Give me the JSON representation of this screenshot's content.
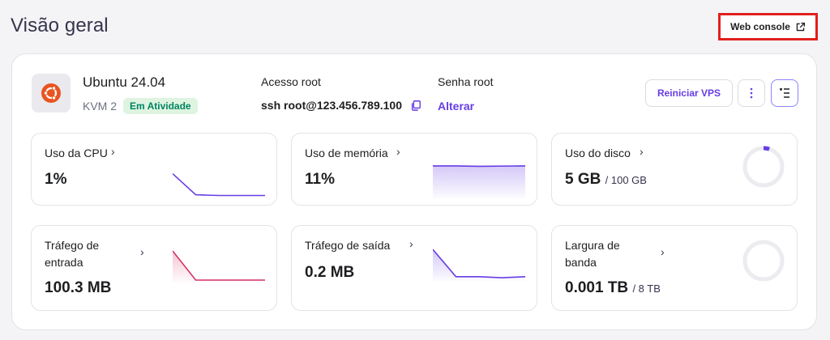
{
  "header": {
    "title": "Visão geral",
    "web_console_label": "Web console"
  },
  "server": {
    "os_name": "Ubuntu 24.04",
    "plan": "KVM 2",
    "status": "Em Atividade",
    "root_access_label": "Acesso root",
    "root_access_value": "ssh root@123.456.789.100",
    "password_label": "Senha root",
    "password_action": "Alterar",
    "restart_label": "Reiniciar VPS"
  },
  "metrics": {
    "cpu": {
      "label": "Uso da CPU",
      "value": "1%",
      "trend": [
        0.7,
        0.08,
        0.06,
        0.06
      ]
    },
    "memory": {
      "label": "Uso de memória",
      "value": "11%",
      "trend": [
        0.93,
        0.93,
        0.92,
        0.93
      ]
    },
    "disk": {
      "label": "Uso do disco",
      "value": "5 GB",
      "total": "/ 100 GB",
      "fraction": 0.05
    },
    "traffic_in": {
      "label_line1": "Tráfego de",
      "label_line2": "entrada",
      "value": "100.3 MB",
      "trend": [
        0.95,
        0.05,
        0.05,
        0.05
      ]
    },
    "traffic_out": {
      "label": "Tráfego de saída",
      "value": "0.2 MB",
      "trend": [
        0.9,
        0.1,
        0.1,
        0.07,
        0.1
      ]
    },
    "bandwidth": {
      "label_line1": "Largura de",
      "label_line2": "banda",
      "value": "0.001 TB",
      "total": "/ 8 TB",
      "fraction": 0.0
    }
  },
  "colors": {
    "accent": "#673de6",
    "cpu_line": "#673de6",
    "traffic_in_line": "#d63163",
    "success": "#008361"
  }
}
